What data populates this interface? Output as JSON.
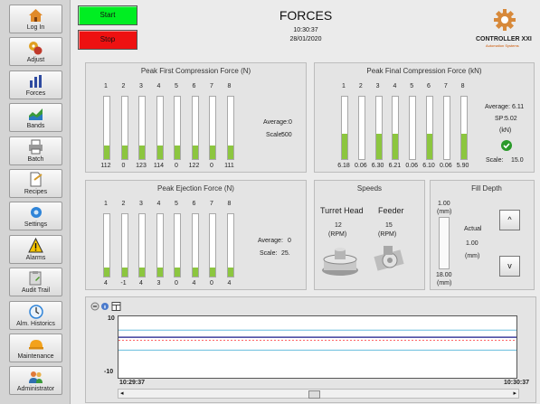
{
  "colors": {
    "start": "#00ee22",
    "stop": "#ee1111",
    "bar": "#8cc63f",
    "accent": "#cc7a22"
  },
  "sidebar": {
    "items": [
      {
        "label": "Log In",
        "icon": "house-icon"
      },
      {
        "label": "Adjust",
        "icon": "gears-icon"
      },
      {
        "label": "Forces",
        "icon": "bar-chart-icon"
      },
      {
        "label": "Bands",
        "icon": "area-chart-icon"
      },
      {
        "label": "Batch",
        "icon": "printer-icon"
      },
      {
        "label": "Recipes",
        "icon": "document-icon"
      },
      {
        "label": "Settings",
        "icon": "settings-icon"
      },
      {
        "label": "Alarms",
        "icon": "warning-icon"
      },
      {
        "label": "Audit Trail",
        "icon": "clipboard-icon"
      },
      {
        "label": "Alm. Historics",
        "icon": "history-icon"
      },
      {
        "label": "Maintenance",
        "icon": "hardhat-icon"
      },
      {
        "label": "Administrator",
        "icon": "users-icon"
      }
    ]
  },
  "header": {
    "start": "Start",
    "stop": "Stop",
    "title": "FORCES",
    "time": "10:30:37",
    "date": "28/01/2020",
    "logo_text": "CONTROLLER XXI",
    "logo_sub": "Automation Systems"
  },
  "first": {
    "title": "Peak First Compression Force (N)",
    "labels": [
      "1",
      "2",
      "3",
      "4",
      "5",
      "6",
      "7",
      "8"
    ],
    "values": [
      "112",
      "0",
      "123",
      "114",
      "0",
      "122",
      "0",
      "111"
    ],
    "levels": [
      0.22,
      0.22,
      0.22,
      0.22,
      0.22,
      0.22,
      0.22,
      0.22
    ],
    "avg_label": "Average:",
    "avg": "0",
    "scale_label": "Scale:",
    "scale": "500"
  },
  "final": {
    "title": "Peak Final Compression Force (kN)",
    "labels": [
      "1",
      "2",
      "3",
      "4",
      "5",
      "6",
      "7",
      "8"
    ],
    "values": [
      "6.18",
      "0.06",
      "6.30",
      "6.21",
      "0.06",
      "6.10",
      "0.06",
      "5.90"
    ],
    "levels": [
      0.4,
      0,
      0.4,
      0.4,
      0,
      0.4,
      0,
      0.4
    ],
    "avg_label": "Average:",
    "avg": "6.11",
    "sp_label": "SP:",
    "sp": "5.02",
    "unit": "(kN)",
    "scale_label": "Scale:",
    "scale": "15.0"
  },
  "ejection": {
    "title": "Peak Ejection Force (N)",
    "labels": [
      "1",
      "2",
      "3",
      "4",
      "5",
      "6",
      "7",
      "8"
    ],
    "values": [
      "4",
      "-1",
      "4",
      "3",
      "0",
      "4",
      "0",
      "4"
    ],
    "levels": [
      0.14,
      0.14,
      0.14,
      0.14,
      0.14,
      0.14,
      0.14,
      0.14
    ],
    "avg_label": "Average:",
    "avg": "0",
    "scale_label": "Scale:",
    "scale": "25."
  },
  "speeds": {
    "title": "Speeds",
    "turret": "Turret Head",
    "turret_val": "12",
    "turret_unit": "(RPM)",
    "feeder": "Feeder",
    "feeder_val": "15",
    "feeder_unit": "(RPM)"
  },
  "fill": {
    "title": "Fill Depth",
    "top": "1.00",
    "top_unit": "(mm)",
    "bottom": "18.00",
    "bottom_unit": "(mm)",
    "actual_label": "Actual",
    "actual": "1.00",
    "actual_unit": "(mm)",
    "up": "^",
    "down": "v"
  },
  "trend": {
    "y_max": "10",
    "y_min": "-10",
    "x_start": "10:29:37",
    "x_end": "10:30:37"
  },
  "chart_data": {
    "type": "line",
    "ylim": [
      -10,
      10
    ],
    "x": [
      "10:29:37",
      "10:30:37"
    ],
    "series": [
      {
        "values": [
          5.5,
          5.5
        ],
        "color": "#66bbdd"
      },
      {
        "values": [
          3.2,
          3.2
        ],
        "color": "#1a1a8a"
      },
      {
        "values": [
          2.2,
          2.2
        ],
        "color": "#ff6666",
        "dashed": true
      },
      {
        "values": [
          -1.0,
          -1.0
        ],
        "color": "#66bbdd"
      }
    ]
  }
}
